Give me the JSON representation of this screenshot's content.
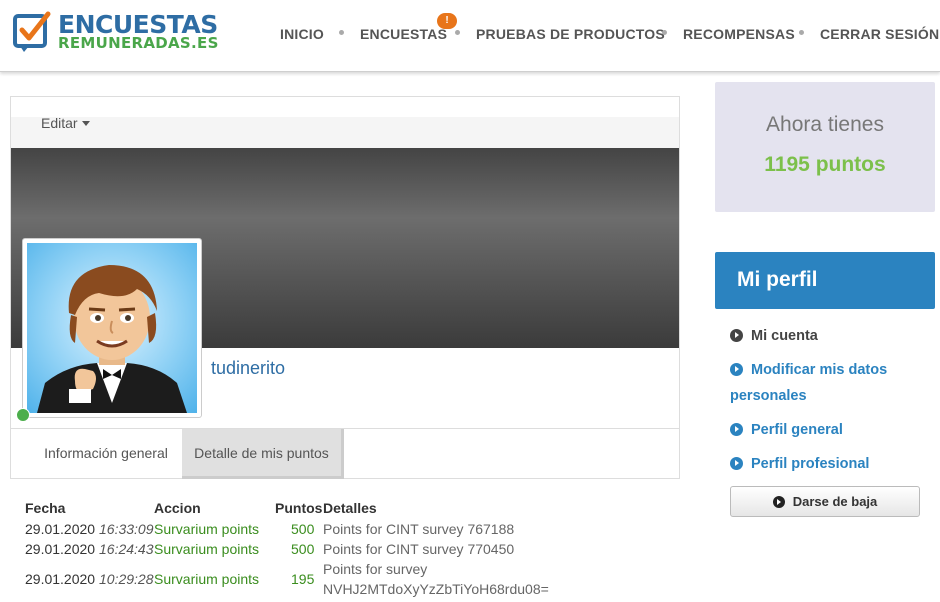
{
  "logo": {
    "line1": "ENCUESTAS",
    "line2": "REMUNERADAS.ES"
  },
  "nav": {
    "items": [
      "INICIO",
      "ENCUESTAS",
      "PRUEBAS DE PRODUCTOS",
      "RECOMPENSAS",
      "CERRAR SESIÓN"
    ],
    "badge": "!"
  },
  "profile": {
    "edit_label": "Editar",
    "username": "tudinerito",
    "tabs": [
      "Información general",
      "Detalle de mis puntos"
    ]
  },
  "points_table": {
    "headers": [
      "Fecha",
      "Accion",
      "Puntos",
      "Detalles"
    ],
    "rows": [
      {
        "date": "29.01.2020",
        "time": "16:33:09",
        "action": "Survarium points",
        "points": "500",
        "detail1": "Points for CINT survey 767188",
        "detail2": ""
      },
      {
        "date": "29.01.2020",
        "time": "16:24:43",
        "action": "Survarium points",
        "points": "500",
        "detail1": "Points for CINT survey 770450",
        "detail2": ""
      },
      {
        "date": "29.01.2020",
        "time": "10:29:28",
        "action": "Survarium points",
        "points": "195",
        "detail1": "Points for survey",
        "detail2": "NVHJ2MTdoXyYzZbTiYoH68rdu08="
      }
    ]
  },
  "sidebar": {
    "points_title": "Ahora tienes",
    "points_value": "1195 puntos",
    "profile_title": "Mi perfil",
    "menu": [
      "Mi cuenta",
      "Modificar mis datos",
      "personales",
      "Perfil general",
      "Perfil profesional"
    ],
    "unsubscribe": "Darse de baja"
  },
  "colors": {
    "brand_blue": "#2b83c0",
    "brand_green": "#7cc04b",
    "badge_orange": "#e8751a",
    "link_green": "#3a8d1e"
  }
}
